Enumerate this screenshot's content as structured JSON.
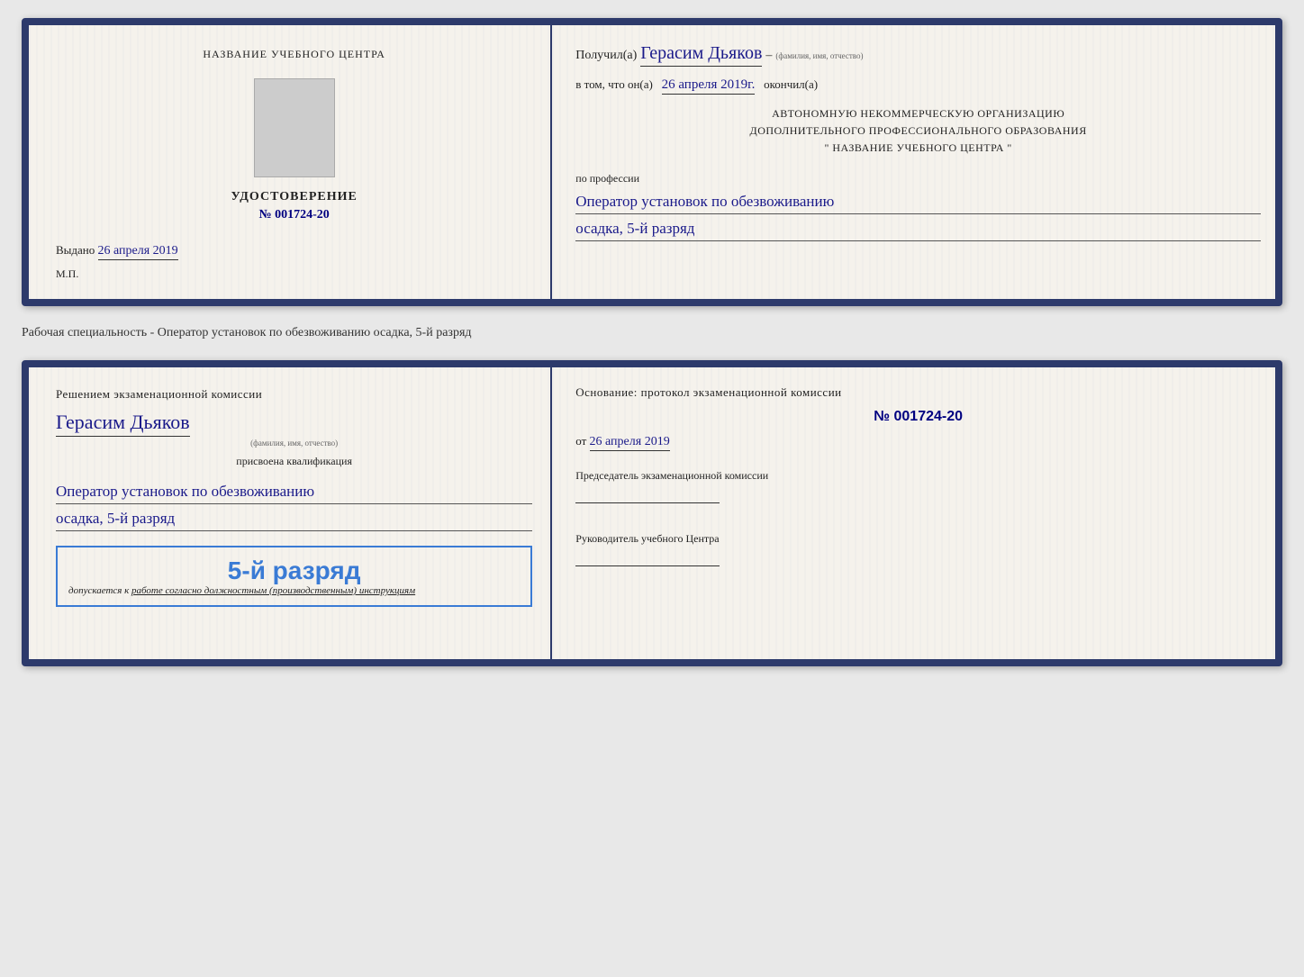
{
  "page": {
    "background_color": "#e8e8e8"
  },
  "cert_top": {
    "left": {
      "center_name_label": "НАЗВАНИЕ УЧЕБНОГО ЦЕНТРА",
      "title": "УДОСТОВЕРЕНИЕ",
      "number": "№ 001724-20",
      "issued_label": "Выдано",
      "issued_date": "26 апреля 2019",
      "stamp_label": "М.П."
    },
    "right": {
      "received_prefix": "Получил(а)",
      "recipient_name": "Герасим Дьяков",
      "fio_sublabel": "(фамилия, имя, отчество)",
      "dash": "–",
      "in_that_prefix": "в том, что он(а)",
      "completion_date": "26 апреля 2019г.",
      "finished_label": "окончил(а)",
      "org_line1": "АВТОНОМНУЮ НЕКОММЕРЧЕСКУЮ ОРГАНИЗАЦИЮ",
      "org_line2": "ДОПОЛНИТЕЛЬНОГО ПРОФЕССИОНАЛЬНОГО ОБРАЗОВАНИЯ",
      "org_name_label": "\"    НАЗВАНИЕ УЧЕБНОГО ЦЕНТРА    \"",
      "profession_label": "по профессии",
      "profession_line1": "Оператор установок по обезвоживанию",
      "profession_line2": "осадка, 5-й разряд"
    }
  },
  "specialty_text": "Рабочая специальность - Оператор установок по обезвоживанию осадка, 5-й разряд",
  "cert_bottom": {
    "left": {
      "commission_title": "Решением экзаменационной комиссии",
      "person_name": "Герасим Дьяков",
      "fio_sublabel": "(фамилия, имя, отчество)",
      "assigned_text": "присвоена квалификация",
      "qualification_line1": "Оператор установок по обезвоживанию",
      "qualification_line2": "осадка, 5-й разряд",
      "grade_text": "5-й разряд",
      "admission_text": "допускается к работе согласно должностным (производственным) инструкциям"
    },
    "right": {
      "basis_title": "Основание: протокол экзаменационной комиссии",
      "protocol_number": "№  001724-20",
      "date_prefix": "от",
      "date_value": "26 апреля 2019",
      "chairman_title": "Председатель экзаменационной комиссии",
      "director_title": "Руководитель учебного Центра"
    }
  }
}
